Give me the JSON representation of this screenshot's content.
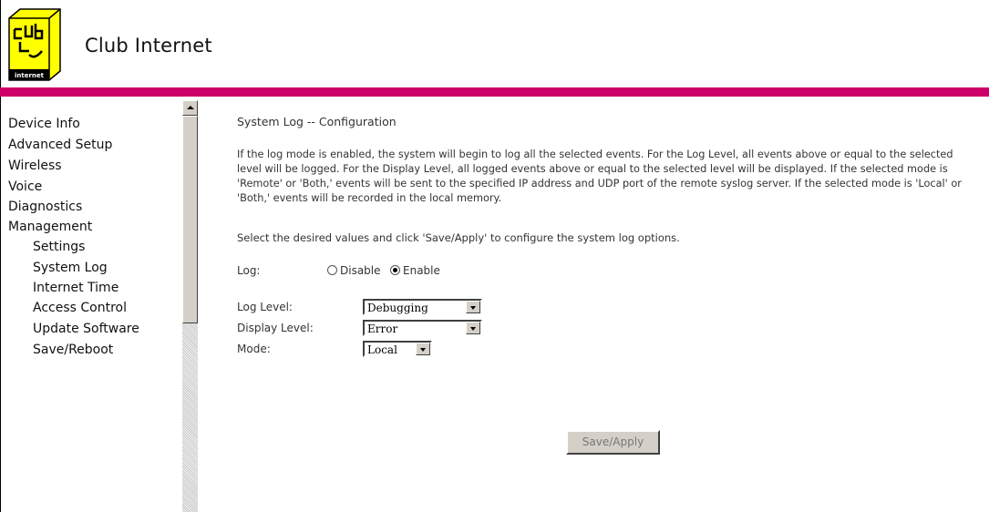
{
  "header": {
    "logo_text": "Club Internet",
    "logo_mark_line1": "CLUB",
    "logo_mark_line2": "internet"
  },
  "sidebar": {
    "items": [
      {
        "label": "Device Info"
      },
      {
        "label": "Advanced Setup"
      },
      {
        "label": "Wireless"
      },
      {
        "label": "Voice"
      },
      {
        "label": "Diagnostics"
      },
      {
        "label": "Management"
      }
    ],
    "subitems": [
      {
        "label": "Settings"
      },
      {
        "label": "System Log"
      },
      {
        "label": "Internet Time"
      },
      {
        "label": "Access Control"
      },
      {
        "label": "Update Software"
      },
      {
        "label": "Save/Reboot"
      }
    ]
  },
  "main": {
    "title": "System Log -- Configuration",
    "description": "If the log mode is enabled, the system will begin to log all the selected events. For the Log Level, all events above or equal to the selected level will be logged. For the Display Level, all logged events above or equal to the selected level will be displayed. If the selected mode is 'Remote' or 'Both,' events will be sent to the specified IP address and UDP port of the remote syslog server. If the selected mode is 'Local' or 'Both,' events will be recorded in the local memory.",
    "instruction": "Select the desired values and click 'Save/Apply' to configure the system log options.",
    "log": {
      "label": "Log:",
      "disable_label": "Disable",
      "enable_label": "Enable",
      "selected": "Enable"
    },
    "log_level": {
      "label": "Log Level:",
      "value": "Debugging"
    },
    "display_level": {
      "label": "Display Level:",
      "value": "Error"
    },
    "mode": {
      "label": "Mode:",
      "value": "Local"
    },
    "save_label": "Save/Apply"
  },
  "colors": {
    "header_bar": "#cc0066",
    "logo_yellow": "#ffff00"
  }
}
